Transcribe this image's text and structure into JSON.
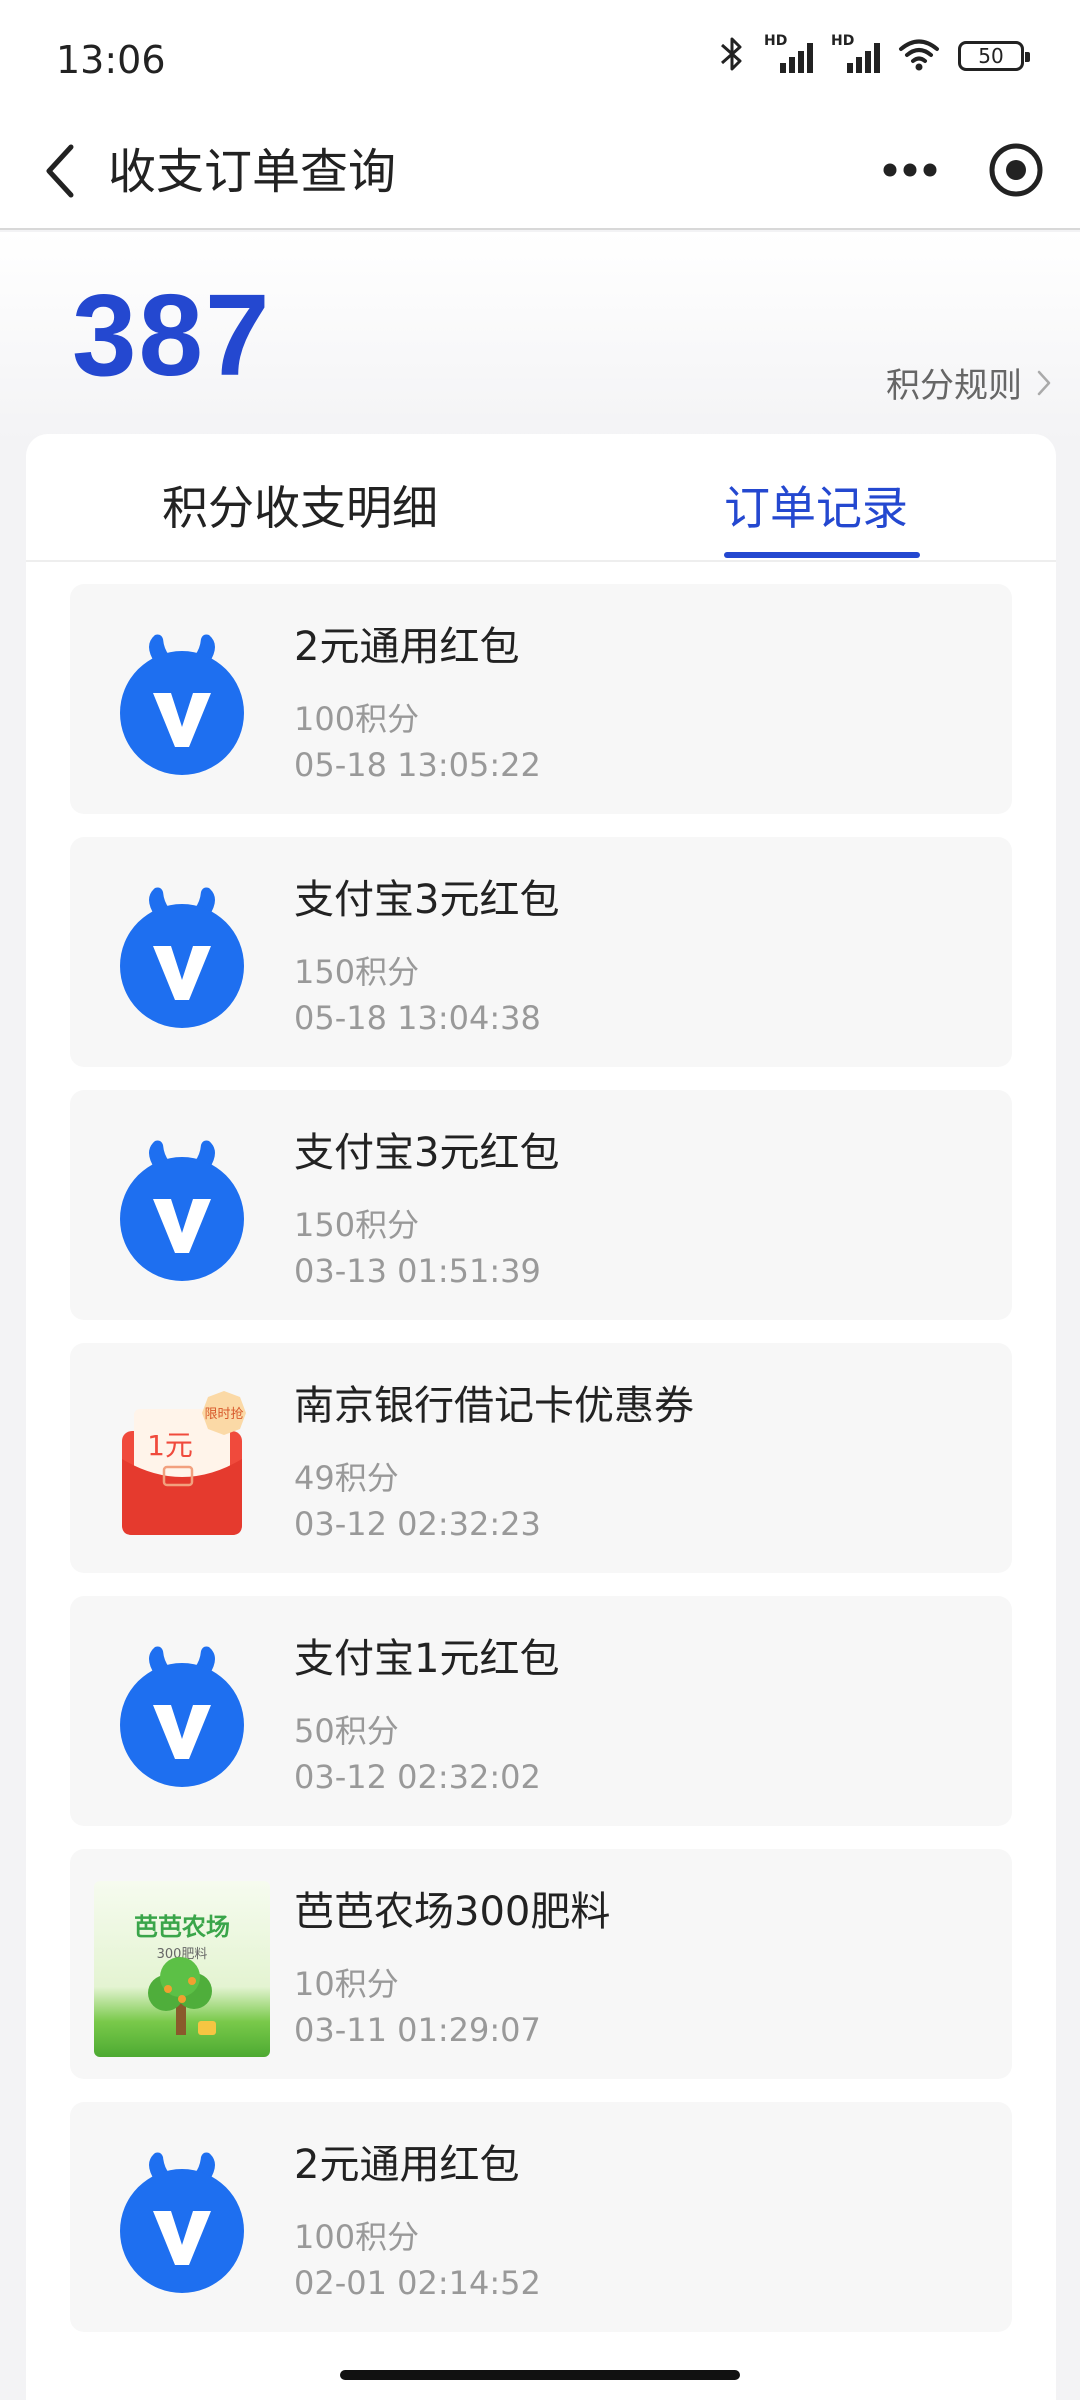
{
  "status_bar": {
    "time": "13:06",
    "signal_labels": [
      "HD",
      "HD"
    ],
    "battery": "50",
    "icons": [
      "bluetooth-icon",
      "signal-icon",
      "signal-icon",
      "wifi-icon",
      "battery-icon"
    ]
  },
  "nav": {
    "title": "收支订单查询",
    "icons": [
      "back-icon",
      "more-icon",
      "target-icon"
    ]
  },
  "points": {
    "value": "387",
    "rules_label": "积分规则"
  },
  "tabs": [
    {
      "label": "积分收支明细",
      "active": false
    },
    {
      "label": "订单记录",
      "active": true
    }
  ],
  "orders": [
    {
      "name": "2元通用红包",
      "cost": "100积分",
      "time": "05-18 13:05:22",
      "icon": "alipay-v-icon"
    },
    {
      "name": "支付宝3元红包",
      "cost": "150积分",
      "time": "05-18 13:04:38",
      "icon": "alipay-v-icon"
    },
    {
      "name": "支付宝3元红包",
      "cost": "150积分",
      "time": "03-13 01:51:39",
      "icon": "alipay-v-icon"
    },
    {
      "name": "南京银行借记卡优惠券",
      "cost": "49积分",
      "time": "03-12 02:32:23",
      "icon": "red-envelope-icon"
    },
    {
      "name": "支付宝1元红包",
      "cost": "50积分",
      "time": "03-12 02:32:02",
      "icon": "alipay-v-icon"
    },
    {
      "name": "芭芭农场300肥料",
      "cost": "10积分",
      "time": "03-11 01:29:07",
      "icon": "farm-icon"
    },
    {
      "name": "2元通用红包",
      "cost": "100积分",
      "time": "02-01 02:14:52",
      "icon": "alipay-v-icon"
    }
  ],
  "coupon_icon": {
    "badge": "限时抢",
    "amount": "1元"
  },
  "farm_icon": {
    "title": "芭芭农场",
    "subtitle": "300肥料"
  },
  "colors": {
    "accent": "#2448d0",
    "alipay_blue": "#1e6ff0",
    "coupon_red": "#f04a3c"
  }
}
